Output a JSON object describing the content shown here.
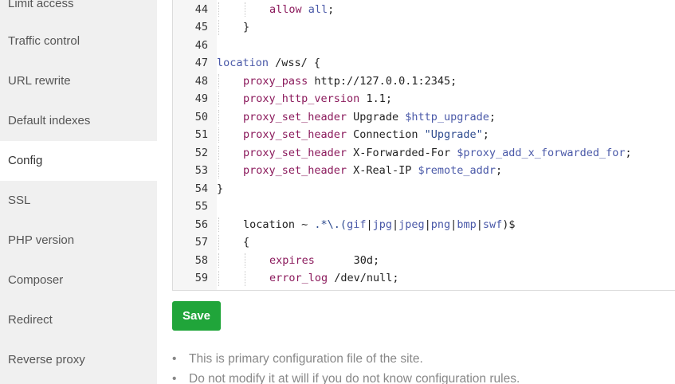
{
  "sidebar": {
    "items": [
      {
        "label": "Limit access"
      },
      {
        "label": "Traffic control"
      },
      {
        "label": "URL rewrite"
      },
      {
        "label": "Default indexes"
      },
      {
        "label": "Config",
        "active": true
      },
      {
        "label": "SSL"
      },
      {
        "label": "PHP version"
      },
      {
        "label": "Composer"
      },
      {
        "label": "Redirect"
      },
      {
        "label": "Reverse proxy"
      }
    ]
  },
  "editor": {
    "lines": [
      {
        "num": "44",
        "indent": 2,
        "tokens": [
          {
            "t": "allow",
            "c": "kw"
          },
          {
            "t": " "
          },
          {
            "t": "all",
            "c": "var"
          },
          {
            "t": ";"
          }
        ]
      },
      {
        "num": "45",
        "indent": 1,
        "tokens": [
          {
            "t": "}"
          }
        ]
      },
      {
        "num": "46",
        "indent": 0,
        "tokens": []
      },
      {
        "num": "47",
        "indent": 0,
        "tokens": [
          {
            "t": "location",
            "c": "var"
          },
          {
            "t": " /wss/ {"
          }
        ]
      },
      {
        "num": "48",
        "indent": 1,
        "tokens": [
          {
            "t": "proxy_pass",
            "c": "kw"
          },
          {
            "t": " http://127.0.0.1:2345;"
          }
        ]
      },
      {
        "num": "49",
        "indent": 1,
        "tokens": [
          {
            "t": "proxy_http_version",
            "c": "kw"
          },
          {
            "t": " 1.1;"
          }
        ]
      },
      {
        "num": "50",
        "indent": 1,
        "tokens": [
          {
            "t": "proxy_set_header",
            "c": "kw"
          },
          {
            "t": " Upgrade "
          },
          {
            "t": "$http_upgrade",
            "c": "var"
          },
          {
            "t": ";"
          }
        ]
      },
      {
        "num": "51",
        "indent": 1,
        "tokens": [
          {
            "t": "proxy_set_header",
            "c": "kw"
          },
          {
            "t": " Connection "
          },
          {
            "t": "\"Upgrade\"",
            "c": "str"
          },
          {
            "t": ";"
          }
        ]
      },
      {
        "num": "52",
        "indent": 1,
        "tokens": [
          {
            "t": "proxy_set_header",
            "c": "kw"
          },
          {
            "t": " X-Forwarded-For "
          },
          {
            "t": "$proxy_add_x_forwarded_for",
            "c": "var"
          },
          {
            "t": ";"
          }
        ]
      },
      {
        "num": "53",
        "indent": 1,
        "tokens": [
          {
            "t": "proxy_set_header",
            "c": "kw"
          },
          {
            "t": " X-Real-IP "
          },
          {
            "t": "$remote_addr",
            "c": "var"
          },
          {
            "t": ";"
          }
        ]
      },
      {
        "num": "54",
        "indent": 0,
        "tokens": [
          {
            "t": "}"
          }
        ]
      },
      {
        "num": "55",
        "indent": 0,
        "tokens": []
      },
      {
        "num": "56",
        "indent": 1,
        "tokens": [
          {
            "t": "location"
          },
          {
            "t": " ~ "
          },
          {
            "t": ".*\\.(",
            "c": "str"
          },
          {
            "t": "gif",
            "c": "var"
          },
          {
            "t": "|"
          },
          {
            "t": "jpg",
            "c": "var"
          },
          {
            "t": "|"
          },
          {
            "t": "jpeg",
            "c": "var"
          },
          {
            "t": "|"
          },
          {
            "t": "png",
            "c": "var"
          },
          {
            "t": "|"
          },
          {
            "t": "bmp",
            "c": "var"
          },
          {
            "t": "|"
          },
          {
            "t": "swf",
            "c": "var"
          },
          {
            "t": ")$"
          }
        ]
      },
      {
        "num": "57",
        "indent": 1,
        "tokens": [
          {
            "t": "{"
          }
        ]
      },
      {
        "num": "58",
        "indent": 2,
        "tokens": [
          {
            "t": "expires",
            "c": "kw"
          },
          {
            "t": "      30d;"
          }
        ]
      },
      {
        "num": "59",
        "indent": 2,
        "tokens": [
          {
            "t": "error_log",
            "c": "kw"
          },
          {
            "t": " /dev/null;"
          }
        ]
      }
    ]
  },
  "actions": {
    "save_label": "Save"
  },
  "tips": [
    {
      "bullet": "•",
      "text": "This is primary configuration file of the site."
    },
    {
      "bullet": "•",
      "text": "Do not modify it at will if you do not know configuration rules."
    }
  ],
  "colors": {
    "accent": "#20a53a",
    "keyword": "#8b1a5c",
    "variable": "#4a59a8",
    "string": "#2f4c8f"
  }
}
